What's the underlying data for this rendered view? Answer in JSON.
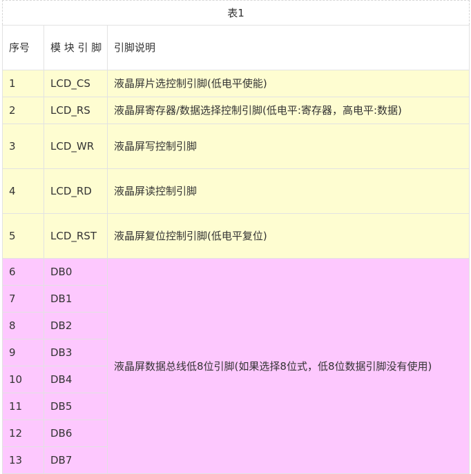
{
  "table": {
    "caption": "表1",
    "headers": [
      "序号",
      "模 块 引 脚",
      "引脚说明"
    ],
    "rows": [
      {
        "no": "1",
        "pin": "LCD_CS",
        "desc": "液晶屏片选控制引脚(低电平使能)"
      },
      {
        "no": "2",
        "pin": "LCD_RS",
        "desc": "液晶屏寄存器/数据选择控制引脚(低电平:寄存器，高电平:数据)"
      },
      {
        "no": "3",
        "pin": "LCD_WR",
        "desc": "液晶屏写控制引脚"
      },
      {
        "no": "4",
        "pin": "LCD_RD",
        "desc": "液晶屏读控制引脚"
      },
      {
        "no": "5",
        "pin": "LCD_RST",
        "desc": "液晶屏复位控制引脚(低电平复位)"
      }
    ],
    "data_rows": [
      {
        "no": "6",
        "pin": "DB0"
      },
      {
        "no": "7",
        "pin": "DB1"
      },
      {
        "no": "8",
        "pin": "DB2"
      },
      {
        "no": "9",
        "pin": "DB3"
      },
      {
        "no": "10",
        "pin": "DB4"
      },
      {
        "no": "11",
        "pin": "DB5"
      },
      {
        "no": "12",
        "pin": "DB6"
      },
      {
        "no": "13",
        "pin": "DB7"
      }
    ],
    "data_desc": "液晶屏数据总线低8位引脚(如果选择8位式，低8位数据引脚没有使用)"
  },
  "colors": {
    "yellow_row": "#fefdd1",
    "pink_row": "#fdc8fe",
    "border": "#e2e2e2"
  }
}
